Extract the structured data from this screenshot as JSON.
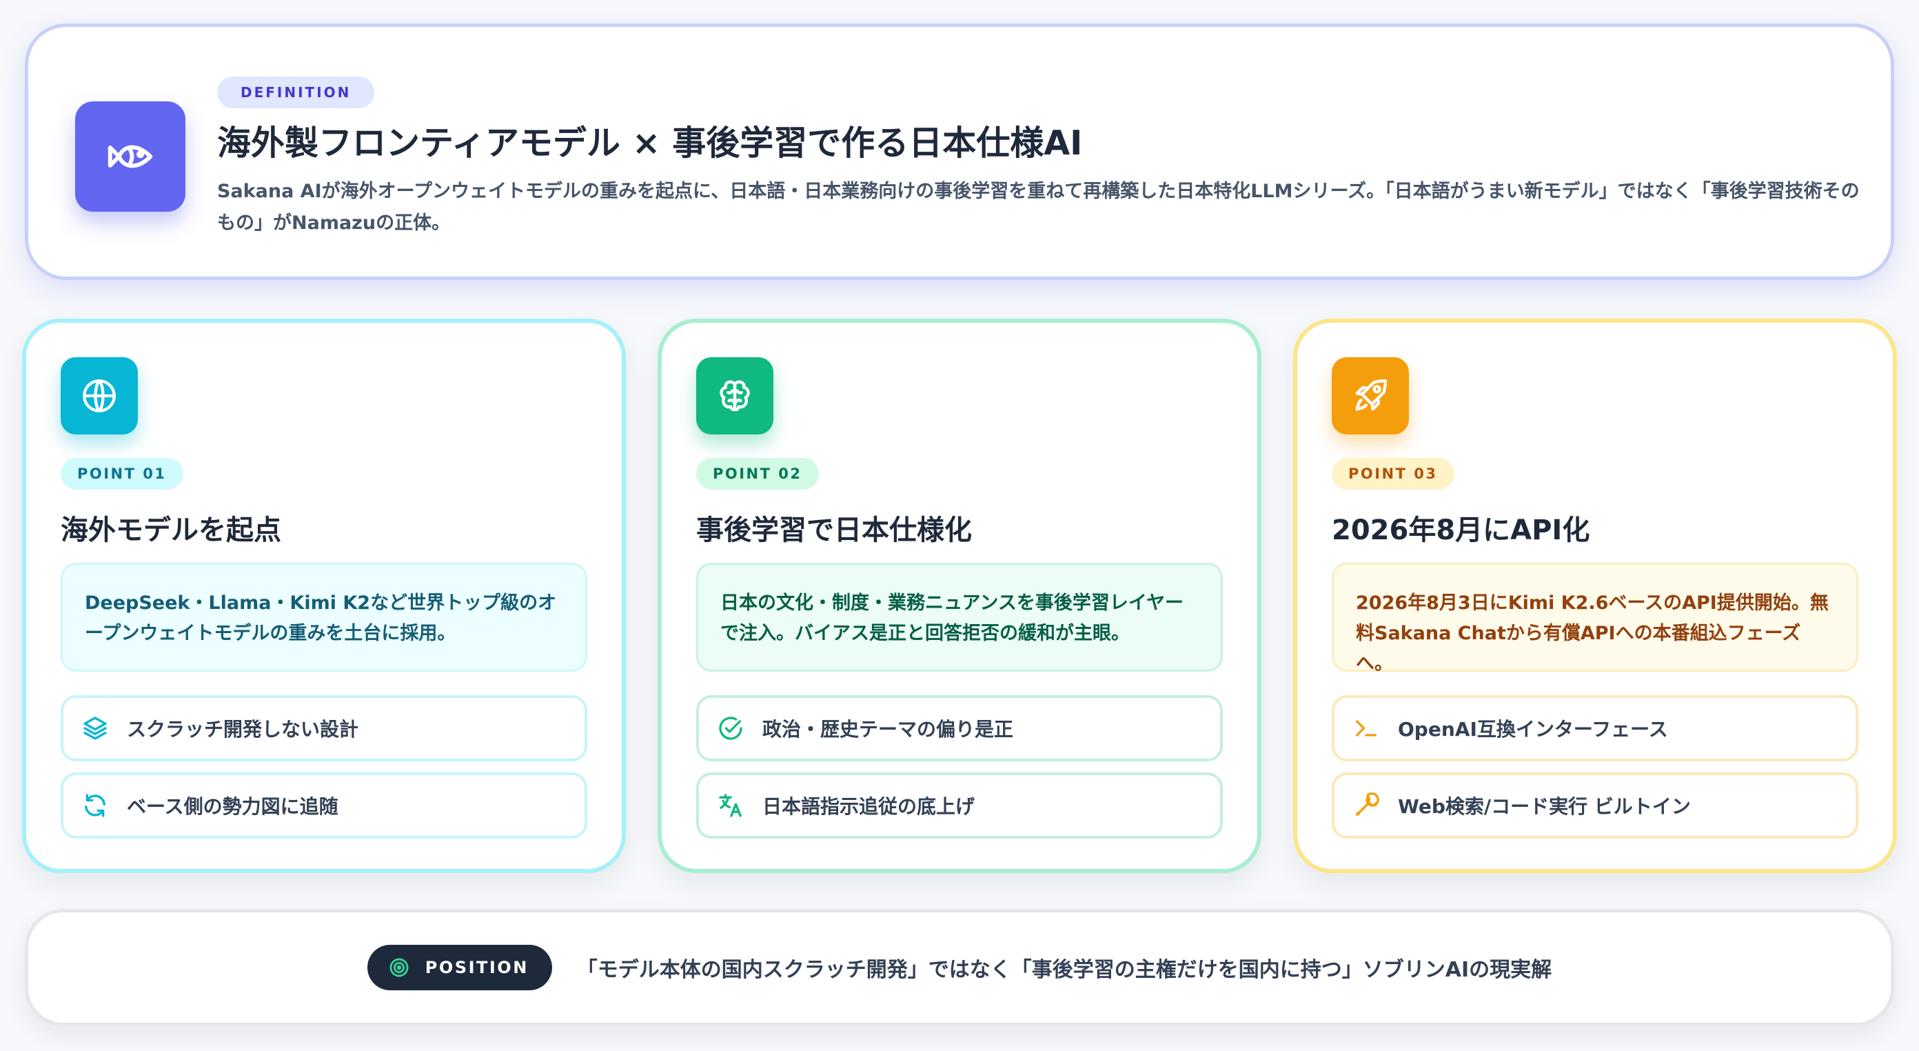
{
  "definition": {
    "badge": "DEFINITION",
    "icon": "fish-icon",
    "title": "海外製フロンティアモデル × 事後学習で作る日本仕様AI",
    "description": "Sakana AIが海外オープンウェイトモデルの重みを起点に、日本語・日本業務向けの事後学習を重ねて再構築した日本特化LLMシリーズ。「日本語がうまい新モデル」ではなく「事後学習技術そのもの」がNamazuの正体。"
  },
  "points": [
    {
      "icon": "globe-icon",
      "badge": "POINT 01",
      "title": "海外モデルを起点",
      "description": "DeepSeek・Llama・Kimi K2など世界トップ級のオープンウェイトモデルの重みを土台に採用。",
      "features": [
        {
          "icon": "layers-icon",
          "label": "スクラッチ開発しない設計"
        },
        {
          "icon": "refresh-icon",
          "label": "ベース側の勢力図に追随"
        }
      ],
      "accent": "#06b6d4"
    },
    {
      "icon": "brain-icon",
      "badge": "POINT 02",
      "title": "事後学習で日本仕様化",
      "description": "日本の文化・制度・業務ニュアンスを事後学習レイヤーで注入。バイアス是正と回答拒否の緩和が主眼。",
      "features": [
        {
          "icon": "check-circle-icon",
          "label": "政治・歴史テーマの偏り是正"
        },
        {
          "icon": "translate-icon",
          "label": "日本語指示追従の底上げ"
        }
      ],
      "accent": "#10b981"
    },
    {
      "icon": "rocket-icon",
      "badge": "POINT 03",
      "title": "2026年8月にAPI化",
      "description": "2026年8月3日にKimi K2.6ベースのAPI提供開始。無料Sakana Chatから有償APIへの本番組込フェーズへ。",
      "features": [
        {
          "icon": "terminal-icon",
          "label": "OpenAI互換インターフェース"
        },
        {
          "icon": "wrench-icon",
          "label": "Web検索/コード実行 ビルトイン"
        }
      ],
      "accent": "#f59e0b"
    }
  ],
  "position": {
    "icon": "target-icon",
    "badge": "POSITION",
    "text": "「モデル本体の国内スクラッチ開発」ではなく「事後学習の主権だけを国内に持つ」ソブリンAIの現実解"
  }
}
